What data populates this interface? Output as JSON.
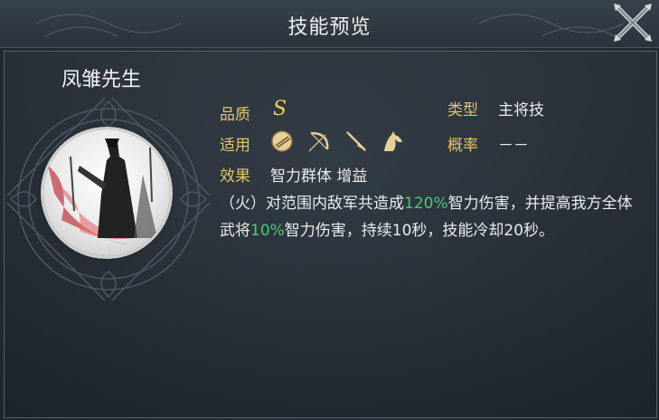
{
  "window": {
    "title": "技能预览"
  },
  "skill": {
    "name": "凤雏先生",
    "quality_label": "品质",
    "quality_value": "S",
    "type_label": "类型",
    "type_value": "主将技",
    "applies_label": "适用",
    "applies_icons": [
      "shield-icon",
      "bow-icon",
      "spear-icon",
      "horse-icon"
    ],
    "rate_label": "概率",
    "rate_value": "－－",
    "effect_label": "效果",
    "effect_value": "智力群体 增益",
    "description": {
      "p1": "（火）对范围内敌军共造成",
      "v1": "120%",
      "p2": "智力伤害，并提高我方全体武将",
      "v2": "10%",
      "p3": "智力伤害，持续10秒，技能冷却20秒。"
    }
  },
  "colors": {
    "label": "#e4c468",
    "highlight": "#4fc87a",
    "grade": "#f1cf55"
  }
}
